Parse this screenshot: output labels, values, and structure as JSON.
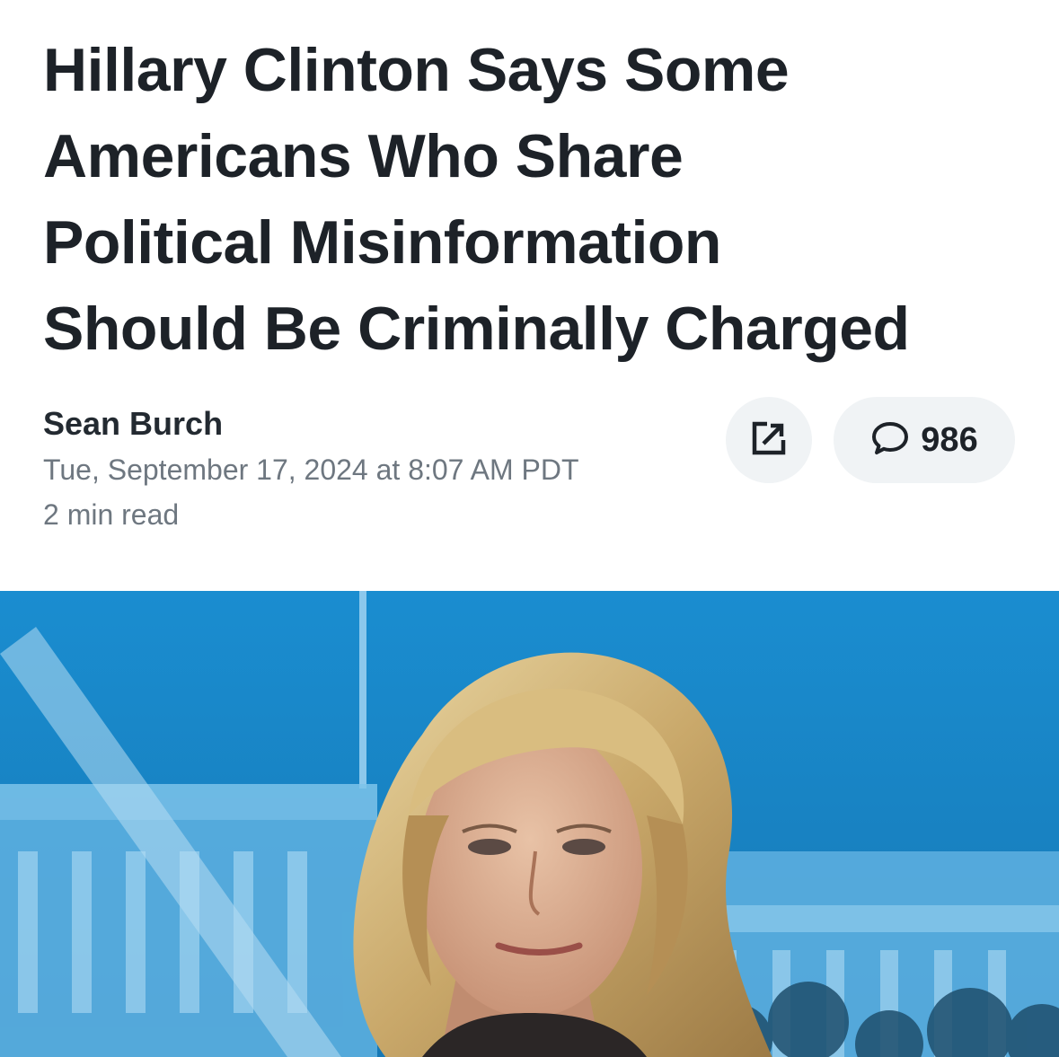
{
  "article": {
    "headline_lines": [
      "Hillary Clinton Says Some",
      "Americans Who Share",
      "Political Misinformation",
      "Should Be Criminally Charged"
    ],
    "author": "Sean Burch",
    "published": "Tue, September 17, 2024 at 8:07 AM PDT",
    "read_time": "2 min read"
  },
  "actions": {
    "share_icon": "share-external-icon",
    "comment_icon": "comment-bubble-icon",
    "comment_count": "986"
  },
  "hero_image": {
    "subject": "woman-with-blonde-hair-portrait",
    "background": "white-house-graphic-blue"
  },
  "colors": {
    "headline": "#1d2228",
    "meta": "#6e7780",
    "pill_bg": "#f0f3f5",
    "hero_blue": "#1b86c4"
  }
}
